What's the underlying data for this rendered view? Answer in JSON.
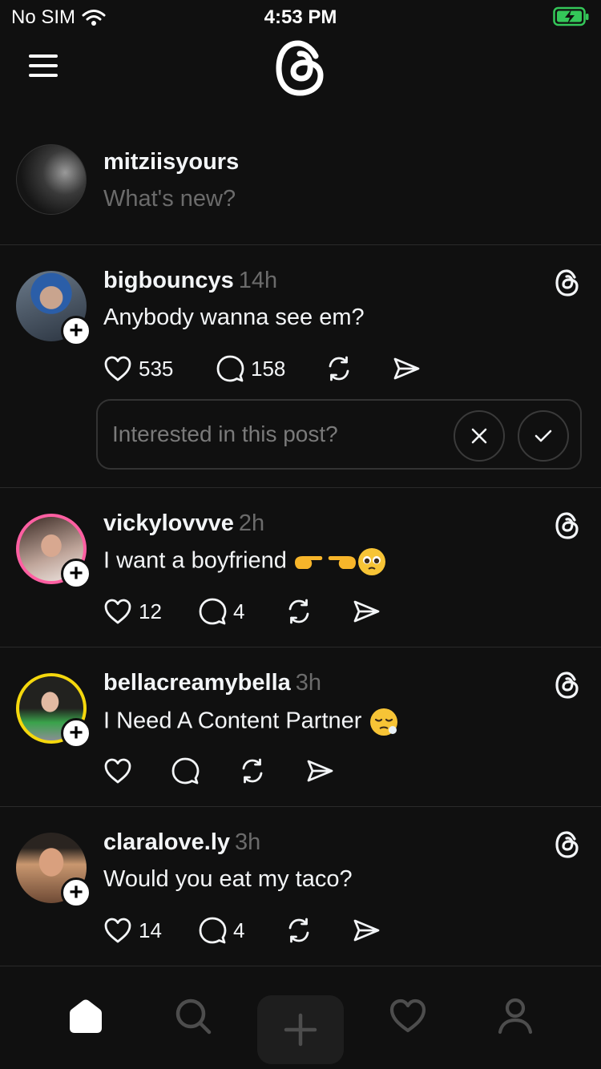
{
  "status_bar": {
    "carrier": "No SIM",
    "time": "4:53 PM"
  },
  "composer": {
    "username": "mitziisyours",
    "placeholder": "What's new?"
  },
  "posts": [
    {
      "username": "bigbouncys",
      "time": "14h",
      "text": "Anybody wanna see em?",
      "likes": "535",
      "replies": "158",
      "interest_prompt": "Interested in this post?"
    },
    {
      "username": "vickylovvve",
      "time": "2h",
      "text": "I want a boyfriend",
      "likes": "12",
      "replies": "4"
    },
    {
      "username": "bellacreamybella",
      "time": "3h",
      "text": "I Need A Content Partner",
      "likes": "",
      "replies": ""
    },
    {
      "username": "claralove.ly",
      "time": "3h",
      "text": "Would you eat my taco?",
      "likes": "14",
      "replies": "4"
    }
  ],
  "tab_bar": {
    "items": [
      "home-icon",
      "search-icon",
      "new-thread-icon",
      "activity-icon",
      "profile-icon"
    ]
  },
  "colors": {
    "background": "#101010",
    "text": "#f3f5f7",
    "muted": "#6b6b6b",
    "divider": "#2a2a2a",
    "battery": "#34c759"
  }
}
